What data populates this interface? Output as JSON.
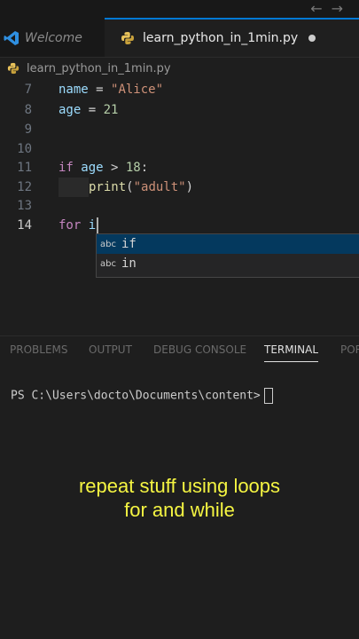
{
  "tabs": {
    "welcome_label": "Welcome",
    "active_label": "learn_python_in_1min.py"
  },
  "breadcrumb": {
    "file": "learn_python_in_1min.py"
  },
  "editor": {
    "lines": [
      {
        "num": "7"
      },
      {
        "num": "8"
      },
      {
        "num": "9"
      },
      {
        "num": "10"
      },
      {
        "num": "11"
      },
      {
        "num": "12"
      },
      {
        "num": "13"
      },
      {
        "num": "14"
      }
    ],
    "tokens": {
      "l7_var": "name",
      "l7_op": " = ",
      "l7_str": "\"Alice\"",
      "l8_var": "age",
      "l8_op": " = ",
      "l8_num": "21",
      "l11_kw": "if",
      "l11_var": " age",
      "l11_op": " > ",
      "l11_num": "18",
      "l11_colon": ":",
      "l12_fn": "print",
      "l12_p1": "(",
      "l12_str": "\"adult\"",
      "l12_p2": ")",
      "l14_kw": "for",
      "l14_var": " i"
    }
  },
  "suggest": {
    "items": [
      {
        "kind": "abc",
        "label": "if"
      },
      {
        "kind": "abc",
        "label": "in"
      }
    ]
  },
  "panel": {
    "tabs": [
      "PROBLEMS",
      "OUTPUT",
      "DEBUG CONSOLE",
      "TERMINAL",
      "POR"
    ],
    "active": "TERMINAL"
  },
  "terminal": {
    "prompt": "PS C:\\Users\\docto\\Documents\\content>"
  },
  "caption": {
    "line1": "repeat stuff using loops",
    "line2": "for and while"
  },
  "colors": {
    "accent": "#0078d4",
    "caption": "#f5f542",
    "keyword": "#c586c0",
    "string": "#ce9178",
    "number": "#b5cea8",
    "variable": "#9cdcfe"
  }
}
